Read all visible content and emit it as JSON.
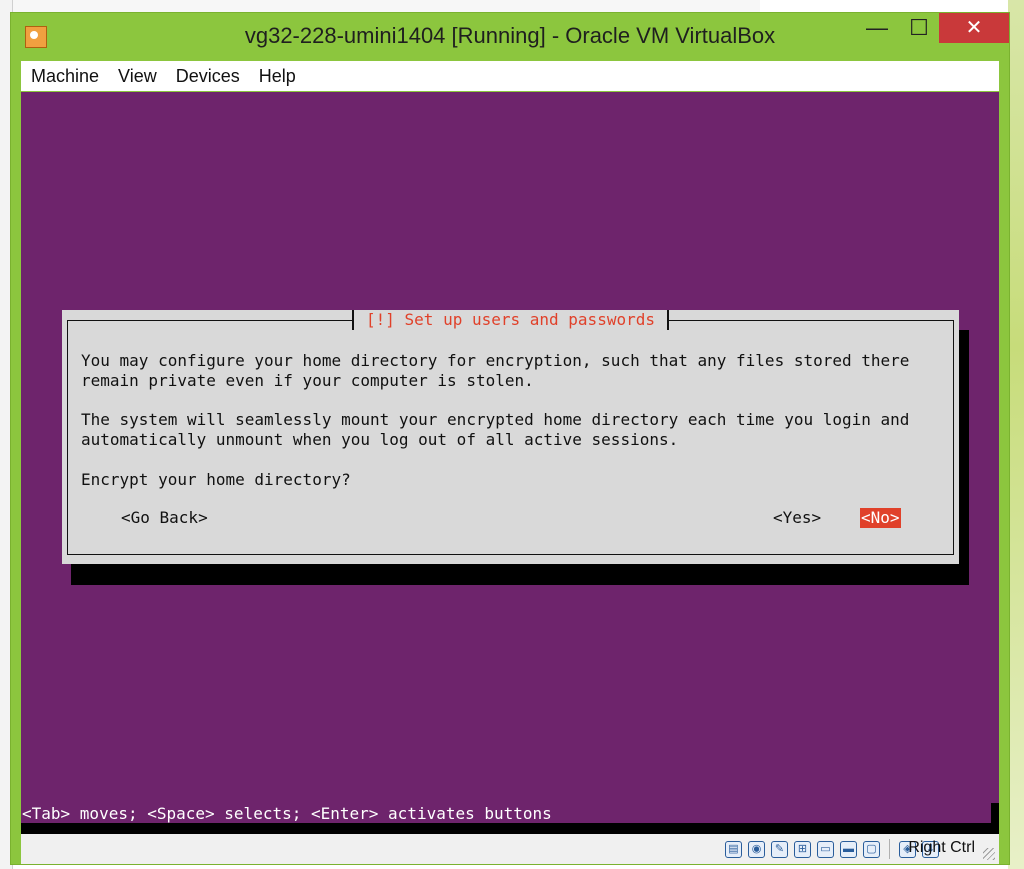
{
  "window": {
    "title": "vg32-228-umini1404 [Running] - Oracle VM VirtualBox",
    "minimize_glyph": "—",
    "maximize_glyph": "☐",
    "close_glyph": "✕"
  },
  "menu": [
    "Machine",
    "View",
    "Devices",
    "Help"
  ],
  "dialog": {
    "title": "[!] Set up users and passwords",
    "paragraph1_line1": "You may configure your home directory for encryption, such that any files stored there",
    "paragraph1_line2": "remain private even if your computer is stolen.",
    "paragraph2_line1": "The system will seamlessly mount your encrypted home directory each time you login and",
    "paragraph2_line2": "automatically unmount when you log out of all active sessions.",
    "question": "Encrypt your home directory?",
    "buttons": {
      "go_back": "<Go Back>",
      "yes": "<Yes>",
      "no": "<No>"
    }
  },
  "console_help": "<Tab> moves; <Space> selects; <Enter> activates buttons",
  "statusbar": {
    "icons": [
      "hard-disk-icon",
      "optical-drive-icon",
      "usb-icon",
      "network-icon",
      "shared-folders-icon",
      "display-icon",
      "video-capture-icon",
      "mouse-integration-icon",
      "host-key-arrow-icon"
    ],
    "host_key": "Right Ctrl"
  },
  "colors": {
    "window_frame": "#8cc63e",
    "vm_background": "#6e246c",
    "dialog_background": "#d9d9d9",
    "accent_red": "#e0412a",
    "close_button": "#c9393a"
  }
}
